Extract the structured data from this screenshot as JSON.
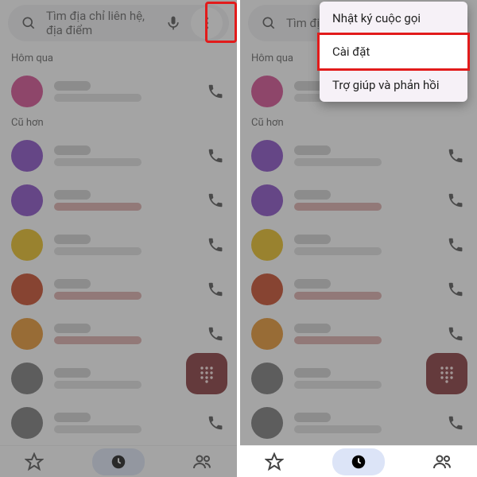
{
  "search_placeholder": "Tìm địa chỉ liên hệ, địa điểm",
  "sections": {
    "yesterday": "Hôm qua",
    "older": "Cũ hơn"
  },
  "menu": {
    "history": "Nhật ký cuộc gọi",
    "settings": "Cài đặt",
    "help": "Trợ giúp và phản hồi"
  },
  "avatar_colors": [
    "#d23b86",
    "#7b3cc0",
    "#7b3cc0",
    "#e8b90c",
    "#c23712",
    "#e78b1a",
    "#6b6b6b",
    "#6b6b6b"
  ],
  "missed_rows": [
    false,
    false,
    true,
    false,
    true,
    true,
    false,
    false
  ],
  "nav": {
    "favorites": "Mục yêu thích",
    "recents": "Gần đây",
    "contacts": "Danh bạ"
  }
}
